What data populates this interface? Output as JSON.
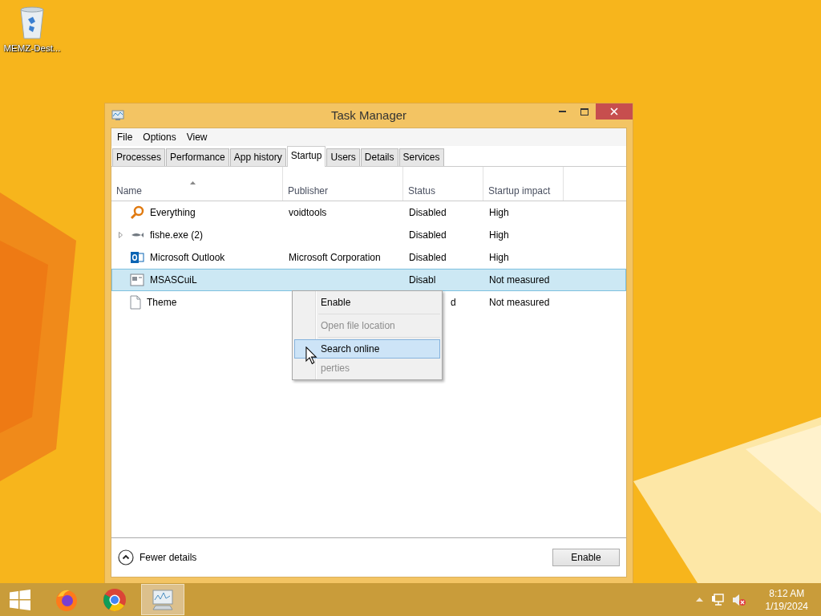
{
  "desktop_icons": [
    {
      "label": "MEMZ-Dest...",
      "kind": "recycle-bin"
    }
  ],
  "window": {
    "title": "Task Manager",
    "menu": [
      "File",
      "Options",
      "View"
    ],
    "tabs": [
      {
        "label": "Processes",
        "selected": false
      },
      {
        "label": "Performance",
        "selected": false
      },
      {
        "label": "App history",
        "selected": false
      },
      {
        "label": "Startup",
        "selected": true
      },
      {
        "label": "Users",
        "selected": false
      },
      {
        "label": "Details",
        "selected": false
      },
      {
        "label": "Services",
        "selected": false
      }
    ],
    "columns": [
      {
        "label": "Name",
        "sorted": true
      },
      {
        "label": "Publisher",
        "sorted": false
      },
      {
        "label": "Status",
        "sorted": false
      },
      {
        "label": "Startup impact",
        "sorted": false
      }
    ],
    "rows": [
      {
        "kind": "magnifier",
        "expandable": false,
        "selected": false,
        "name": "Everything",
        "publisher": "voidtools",
        "status": "Disabled",
        "impact": "High"
      },
      {
        "kind": "fish",
        "expandable": true,
        "selected": false,
        "name": "fishe.exe (2)",
        "status": "Disabled",
        "impact": "High"
      },
      {
        "kind": "outlook",
        "expandable": false,
        "selected": false,
        "name": "Microsoft Outlook",
        "publisher": "Microsoft Corporation",
        "status": "Disabled",
        "impact": "High"
      },
      {
        "kind": "app",
        "expandable": false,
        "selected": true,
        "name": "MSASCuiL",
        "status": "Disabl",
        "impact": "Not measured"
      },
      {
        "kind": "document",
        "expandable": false,
        "selected": false,
        "name": "Theme",
        "status_tail": "d",
        "impact": "Not measured"
      }
    ],
    "context_menu": [
      {
        "label": "Enable",
        "disabled": false,
        "selected": false
      },
      {
        "label": "Open file location",
        "disabled": true,
        "selected": false
      },
      {
        "label": "Search online",
        "disabled": false,
        "selected": true
      },
      {
        "label": "perties",
        "disabled": true,
        "selected": false
      }
    ],
    "fewer_details": "Fewer details",
    "button": "Enable"
  },
  "taskbar": {
    "apps": [
      {
        "kind": "firefox",
        "selected": false
      },
      {
        "kind": "chrome",
        "selected": false
      },
      {
        "kind": "task-manager",
        "selected": true
      }
    ],
    "time": "8:12 AM",
    "date": "1/19/2024"
  }
}
